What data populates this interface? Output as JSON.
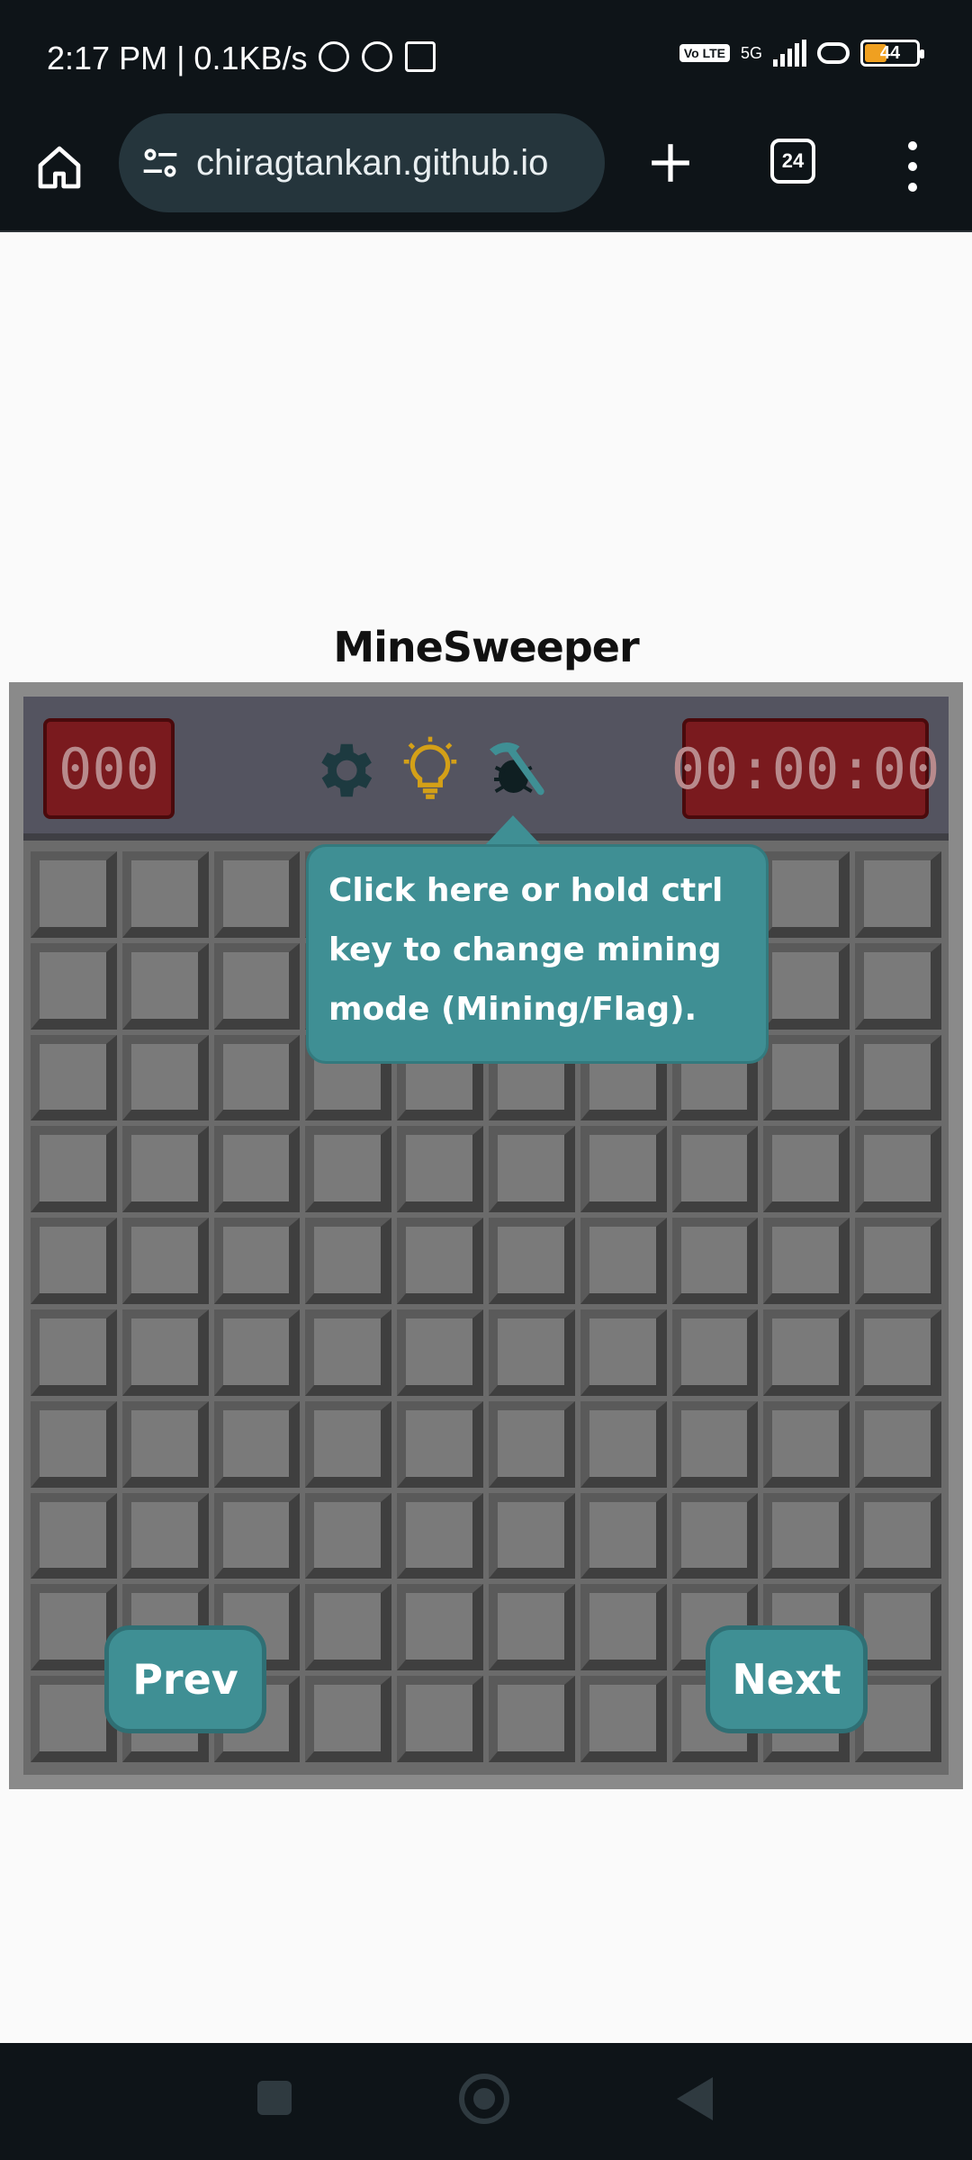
{
  "status_bar": {
    "time_speed": "2:17 PM | 0.1KB/s",
    "volte": "Vo LTE",
    "network": "5G",
    "battery": "44"
  },
  "browser": {
    "url": "chiragtankan.github.io",
    "tab_count": "24"
  },
  "page": {
    "title": "MineSweeper",
    "mine_counter": "000",
    "timer": "00:00:00",
    "tooltip": "Click here or hold ctrl key to change mining mode (Mining/Flag).",
    "prev_label": "Prev",
    "next_label": "Next",
    "grid_rows": 10,
    "grid_cols": 10
  },
  "colors": {
    "accent": "#3f8f94",
    "counter_bg": "#7a1a1e",
    "bulb": "#d4a017",
    "gear": "#1d3a40"
  },
  "icons": [
    "home-icon",
    "site-settings-icon",
    "plus-icon",
    "tabs-icon",
    "more-menu-icon",
    "gear-icon",
    "lightbulb-icon",
    "hammer-bug-icon"
  ]
}
